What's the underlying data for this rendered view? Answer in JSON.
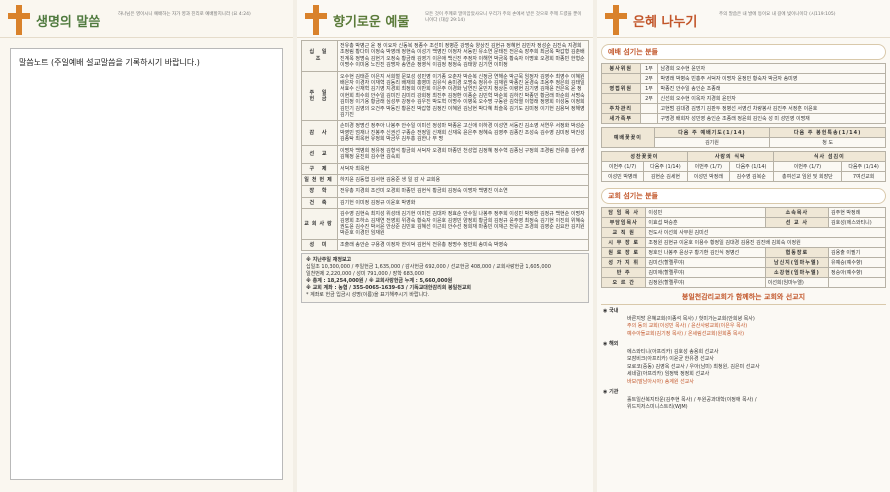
{
  "panel1": {
    "title": "생명의 말씀",
    "subtitle": "하나님은 영이시니 예배하는 자가 영과 진리로 예배할지니라 (요 4:24)",
    "note_label": "말씀노트 (주일예배 설교말씀을 기록하시기 바랍니다.)"
  },
  "panel2": {
    "title": "향기로운 예물",
    "subtitle": "모든 것이 주께로 말미암았사오니 우리가 주의 손에서 받은 것으로 주께 드렸을 뿐이니이다 (대상 29:14)",
    "rows": [
      {
        "key": "십 일 조",
        "text": "전유총 박병근 윤 정 이요자 신동복 정종수 조선미 정병준 강명숙 양상진 김현규 정혜현 김민자 정성순 김진숙 지경희 조정림 황다미 이정숙 박영래 정현숙 이성기 백영진 이정자 서동민 유소연 문태진 전은숙 장주희 최금옥 박갑형 김춘배 진계옥 정명숙 김현기 오정숙 황금래 김영기 이은애 백신진 주정자 이해연 박금옥 황숙자 이명호 오경희 마종빈 한형순 이명수 이미용 노진진 김명자 송연순 정영식 이김정 정정숙 김태양 김기연 이미정"
      },
      {
        "key": "주 일 헌 금",
        "text": "오수현 김태준 이은지 서희철 문보성 성민영 이기종 오춘자 박순복 신정금 연해순 박근묵 임정자 김영수 최영수 이혜원 배은자 이경자 이재혁 김동리 배재희 홍영미 김유식 송미경 오명숙 정유수 김재원 박종진 윤경숙 조용주 정은희 김태일 서효수 신재혁 김기영 지경희 최정희 이만희 이은주 이경화 남연진 윤민지 정상돈 이령현 김기영 김재윤 전은옥 윤 정 이현희 최수희 안수일 김미진 김미리 강희정 최진주 김정환 이종순 김민혁 박순희 김하진 박종민 황금래 마순희 서명숙 김미정 이기용 황금래 심성무 강정수 김우진 박도혁 이명수 이병욱 오수명 구동완 김학열 이형래 정영희 이성동 이정희 김민기 김영의 오건주 박동진 황윤진 박갑형 김정진 이혜원 김남현 박다혜 최슬옥 김기도 김미정 이기헌 김용덕 정해영 김기진"
      },
      {
        "key": "감 사",
        "text": "손미경 정명선 정주아 나봉주 안수일 이미선 정성마 박종윤 고신애 이하경 이성연 서동진 김소영 서연우 서정화 박성순 박영민 엄재나 진봉주 신권선 구종순 전정일 신재희 신재욱 윤은주 정혜숙 김영주 김종진 조성숙 김수영 김미정 박진성 김종탁 최옥현 유정희 박금우 김두홍 김한나 무 명"
      },
      {
        "key": "선 교",
        "text": "이명자 백병희 정유정 김형석 황금희 서덕자 오경희 마종빈 천성엽 김정혜 정수혁 김종님 구정희 조경림 전유총 김수영 김혜정 윤진희 김수현 김숙희"
      },
      {
        "key": "구 제",
        "text": "서덕자 최옥현"
      },
      {
        "key": "일천번제",
        "text": "하지윤 김동엽 김서현 김용준 생 일 감 사 교회용"
      },
      {
        "key": "장 학",
        "text": "전유총 지경희 조선미 오경희 마종빈 김현식 황금희 김정숙 이명자 백병진 이소연"
      },
      {
        "key": "건 축",
        "text": "김기헌 이미정 김정규 이윤호 박영화"
      },
      {
        "key": "교회사랑",
        "text": "김수영 김현숙 최지성 위성태 김기현 이미진 김대자 정효순 안수일 나봉주 정주희 이성민 박정환 김정규 백현순 이명자 김영희 조하소 김재연 전영희 위경숙 황숙자 이윤호 김영민 양정희 황금희 김정규 윤주영 최정숙 김기현 이진희 위혜숙 권도윤 김수진 박서윤 안상준 김민호 김혜선 이근희 안수선 정희재 마종빈 이재근 전유근 조경희 김영순 김요한 김지원 박준호 이경민 임재원"
      },
      {
        "key": "성 미",
        "text": "조출래 송안순 구용경 이정자 한이덕 김현식 전유총 정명수 정만희 송미숙 박영숙"
      }
    ],
    "offering_summary": [
      "※ 지난주일 재정보고",
      "십일조 10,300,000 / 주일헌금 1,635,000 / 감사헌금 692,000 / 선교헌금 408,000 / 교회사랑헌금 1,605,000",
      "일천번제 2,220,000 / 성미 791,000 / 장학 683,000",
      "※ 총계 : 18,254,000원  /  ※ 교회사랑헌금 누계 : 5,660,000원",
      "※ 교회 계좌 : 농협 / 355-0065-1639-63 / 기독교대한감리회 봉일천교회",
      "* 계좌로 헌금 입금시 성명(이름)을 표기해주시기 바랍니다."
    ]
  },
  "panel3": {
    "title": "은혜 나누기",
    "subtitle": "주의 말씀은 내 발에 등이요 내 길에 빛이니이다 (시119:105)",
    "section1": "예배 섬기는 분들",
    "service": [
      {
        "role": "봉사위원",
        "n": "1부",
        "names": "남경희 오수현 윤민자"
      },
      {
        "role": "",
        "n": "2부",
        "names": "박영래 박병숙 빈홍주 서덕자 이명자 윤정민 황숙자 박금자 송미영"
      },
      {
        "role": "영접위원",
        "n": "1부",
        "names": "박종진 안수일 송인순 조종래"
      },
      {
        "role": "",
        "n": "2부",
        "names": "신선희 오수현 이옥자 지경희 윤민자"
      },
      {
        "role": "주차관리",
        "n": "",
        "names": "고현범 김대경 김명기 김판두 정병선 서영선  차량봉사 김진주 서정훈 이윤호"
      },
      {
        "role": "새가족부",
        "n": "",
        "names": "구명경 배희자 성민영 송인순 조종래 정윤희 김인숙  성 미 성민영 이명재"
      }
    ],
    "worship_label": "예배꽃꽂이",
    "worship_next1": "다음 주 예배기도(1/14)",
    "worship_next2": "다음 주 봉헌특송(1/14)",
    "worship_name1": "김기원",
    "worship_name2": "청 도",
    "kitchen_heads": [
      "성찬꽃꽂이",
      "사랑의 식탁",
      "식사 섬김이"
    ],
    "kitchen_rows": [
      [
        "이번주 (1/7)",
        "다음주 (1/14)",
        "이번주 (1/7)",
        "다음주 (1/14)",
        "이번주 (1/7)",
        "다음주 (1/14)"
      ],
      [
        "이성민 박병래",
        "김현순 김세현",
        "이성민 박정래",
        "김수영 김복순",
        "총여선교 임원 및 회장단",
        "7여선교회"
      ]
    ],
    "section2": "교회 섬기는 분들",
    "church": [
      [
        "담 임 목 사",
        "이성민",
        "소속목사",
        "김주현 박정례"
      ],
      [
        "부담임목사",
        "이효섭 박승훈",
        "선 교 사",
        "김호성(에스와티니)"
      ],
      [
        "교 직 원",
        "전도사 이선희 사무원 김미선",
        "",
        ""
      ],
      [
        "시 무 장 로",
        "조정원 김현규 이윤호 이용수 황정일 김대경 김용진 김진배 김희숙 이정원",
        "",
        ""
      ],
      [
        "원 로 장 로",
        "정호인 나봉주 윤상구 황기환 김인식 정병선",
        "협동장로",
        "김용출 이필기"
      ],
      [
        "성 가 지 휘",
        "김미선(할렐루야)",
        "남신지(임마누엘)",
        "유예승(예수향)"
      ],
      [
        "반 주",
        "김미애(할렐루야)",
        "소강현(임마누엘)",
        "정승아(예수향)"
      ],
      [
        "오 르 간",
        "김정원(할렐루야)",
        "이선희(임마누엘)",
        ""
      ]
    ],
    "section3": "봉일천감리교회가 함께하는 교회와 선교지",
    "missions": [
      {
        "cat": "◉ 국내",
        "lines": [
          "바른지방 은혜교회(이종석 목사) / 헛미가는교회(안희녕 목사)",
          "주의 동의 교회(이성민 목사) / 윤산사랑교회(이은우 목사)",
          "예수아들교회(김기정 목사) / 온세림선교회(원희종 목사)"
        ]
      },
      {
        "cat": "◉ 해외",
        "lines": [
          "에스와티니(아프리카) 김호성 송용희 선교사",
          "모잠비크(아프리카) 이윤균 한유경 선교사",
          "모로코(중동) 김영옥 선교사 / 우아(남미) 최청원, 김은미 선교사",
          "세네갈(아프리카) 임정택 정정희 선교사",
          "바보(말남아시아) 송계원 선교사"
        ]
      },
      {
        "cat": "◉ 기관",
        "lines": [
          "홀트일산복지타운(김주현 목사) / 두원공과대학(이정애 목사) /",
          "위드지저스미니스트리(WJM)"
        ]
      }
    ]
  }
}
